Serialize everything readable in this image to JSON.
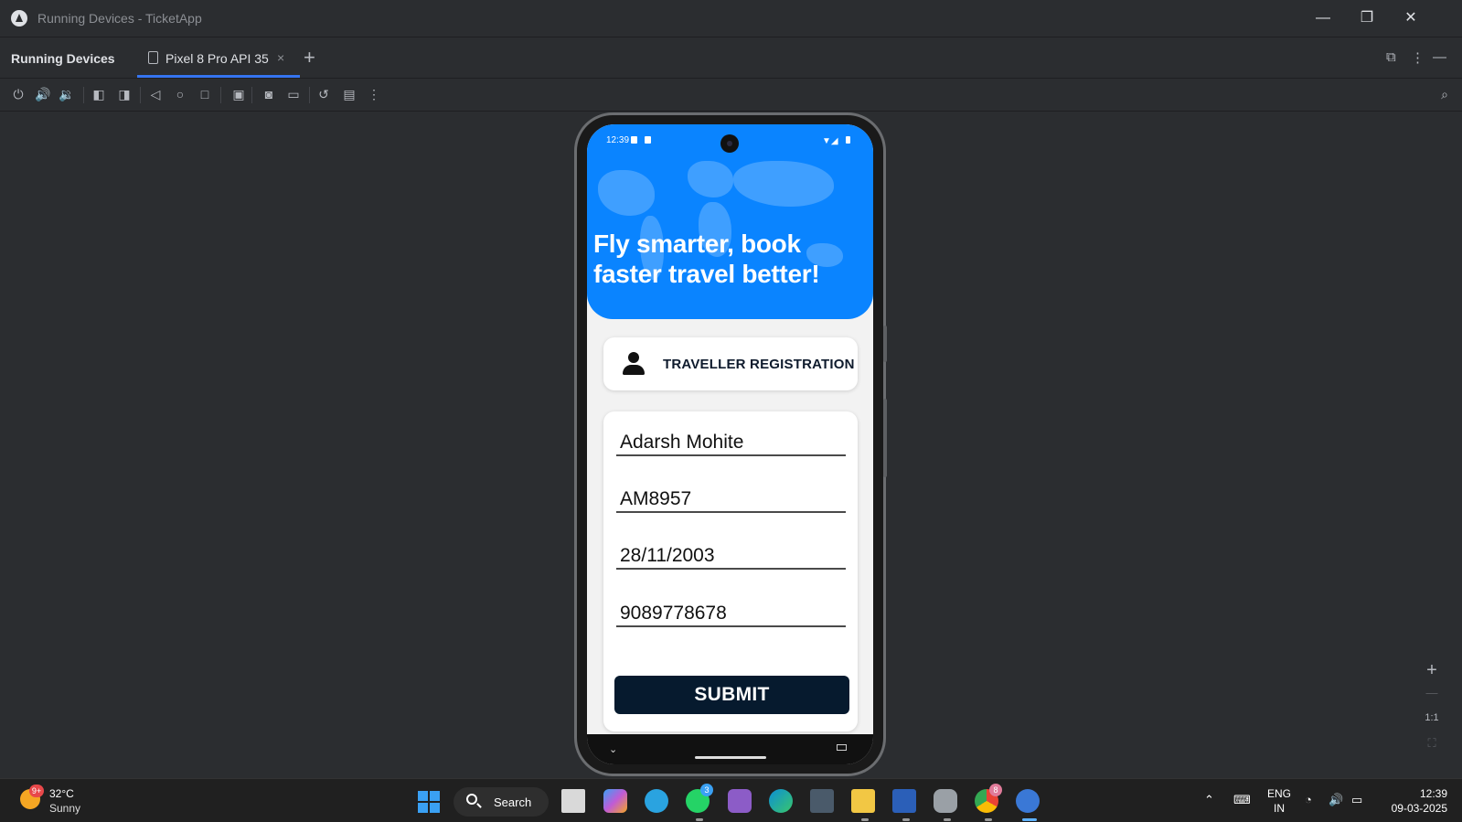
{
  "window": {
    "title": "Running Devices - TicketApp",
    "minimize_glyph": "—",
    "restore_glyph": "❐",
    "close_glyph": "✕"
  },
  "panel": {
    "title": "Running Devices",
    "tabs": [
      {
        "label": "Pixel 8 Pro API 35",
        "close_glyph": "×",
        "icon": "device-tab-icon"
      }
    ],
    "add_tab_glyph": "+"
  },
  "toolbar": {
    "icons": [
      "power-icon",
      "volume-up-icon",
      "volume-down-icon",
      "rotate-left-icon",
      "rotate-right-icon",
      "back-icon",
      "home-icon",
      "overview-icon",
      "app-inspection-icon",
      "screenshot-icon",
      "screen-record-icon",
      "reset-icon",
      "mirror-icon",
      "more-icon"
    ]
  },
  "zoom": {
    "in_glyph": "+",
    "out_glyph": "—",
    "actual_label": "1:1"
  },
  "device": {
    "status_time": "12:39",
    "hero_title": "Fly smarter, book faster travel better!",
    "registration_label": "TRAVELLER REGISTRATION",
    "form": {
      "name_value": "Adarsh Mohite",
      "id_value": "AM8957",
      "dob_value": "28/11/2003",
      "phone_value": "9089778678",
      "submit_label": "SUBMIT"
    },
    "colors": {
      "hero": "#0a84ff",
      "submit": "#061a2e"
    }
  },
  "taskbar": {
    "weather_temp": "32°C",
    "weather_condition": "Sunny",
    "weather_badge": "9+",
    "search_label": "Search",
    "whatsapp_badge": "3",
    "chrome_badge": "8",
    "language_line1": "ENG",
    "language_line2": "IN",
    "time": "12:39",
    "date": "09-03-2025"
  }
}
